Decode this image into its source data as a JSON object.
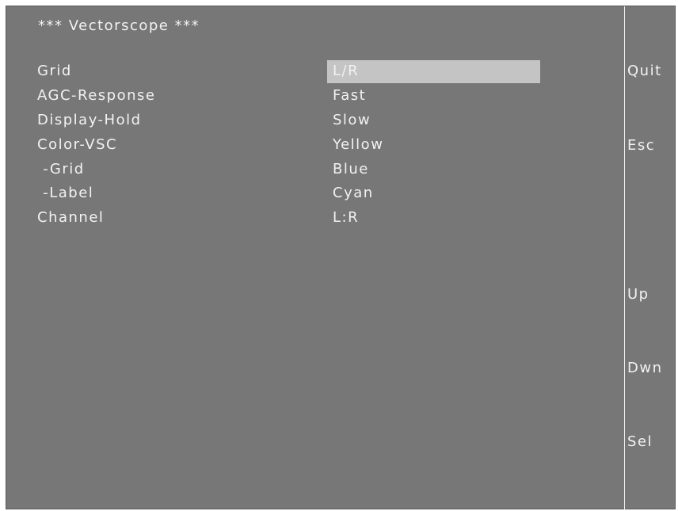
{
  "title": "*** Vectorscope ***",
  "rows": [
    {
      "label": "Grid",
      "value": "L/R"
    },
    {
      "label": "AGC-Response",
      "value": "Fast"
    },
    {
      "label": "Display-Hold",
      "value": "Slow"
    },
    {
      "label": "Color-VSC",
      "value": "Yellow"
    },
    {
      "label": " -Grid",
      "value": "Blue"
    },
    {
      "label": " -Label",
      "value": "Cyan"
    },
    {
      "label": "Channel",
      "value": "L:R"
    }
  ],
  "softkeys": {
    "quit": "Quit",
    "esc": "Esc",
    "up": "Up",
    "down": "Dwn",
    "select": "Sel"
  },
  "colors": {
    "background": "#777777",
    "text": "#f2f2f2",
    "selection": "#c4c4c4"
  }
}
